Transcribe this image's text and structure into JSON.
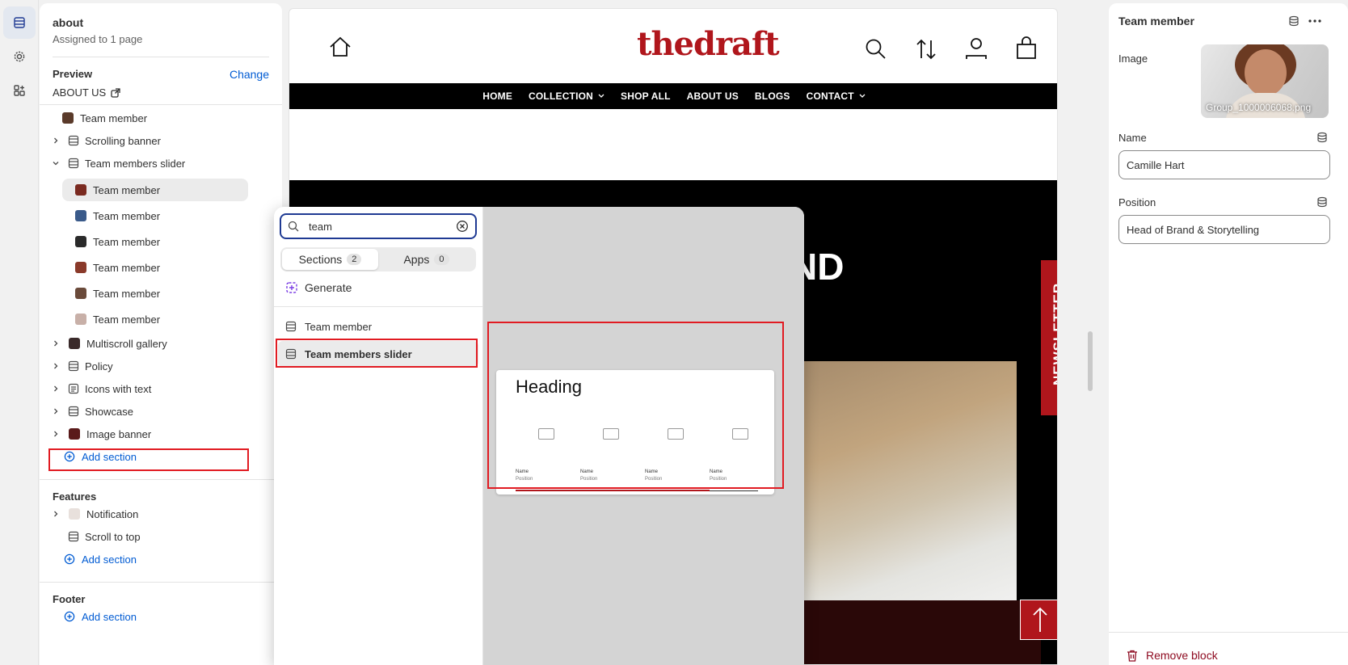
{
  "left_panel": {
    "page_name": "about",
    "assigned": "Assigned to 1 page",
    "preview_label": "Preview",
    "change_label": "Change",
    "preview_page": "ABOUT US",
    "tree": {
      "team_member_top": "Team member",
      "scrolling_banner": "Scrolling banner",
      "team_members_slider": "Team members slider",
      "members": [
        "Team member",
        "Team member",
        "Team member",
        "Team member",
        "Team member",
        "Team member"
      ],
      "multiscroll_gallery": "Multiscroll gallery",
      "policy": "Policy",
      "icons_with_text": "Icons with text",
      "showcase": "Showcase",
      "image_banner": "Image banner",
      "add_section": "Add section"
    },
    "features": {
      "title": "Features",
      "notification": "Notification",
      "scroll_to_top": "Scroll to top",
      "add_section": "Add section"
    },
    "footer": {
      "title": "Footer",
      "add_section": "Add section"
    }
  },
  "preview": {
    "logo_text": "thedraft",
    "nav": [
      {
        "label": "HOME",
        "dropdown": false
      },
      {
        "label": "COLLECTION",
        "dropdown": true
      },
      {
        "label": "SHOP ALL",
        "dropdown": false
      },
      {
        "label": "ABOUT US",
        "dropdown": false
      },
      {
        "label": "BLOGS",
        "dropdown": false
      },
      {
        "label": "CONTACT",
        "dropdown": true
      }
    ],
    "hero_partial": "ND",
    "newsletter": "NEWSLETTER"
  },
  "picker": {
    "search_value": "team",
    "tabs": [
      {
        "label": "Sections",
        "count": "2"
      },
      {
        "label": "Apps",
        "count": "0"
      }
    ],
    "generate": "Generate",
    "results": [
      "Team member",
      "Team members slider"
    ],
    "preview_card": {
      "heading": "Heading",
      "items": [
        {
          "name": "Name",
          "position": "Position"
        },
        {
          "name": "Name",
          "position": "Position"
        },
        {
          "name": "Name",
          "position": "Position"
        },
        {
          "name": "Name",
          "position": "Position"
        }
      ],
      "progress_fraction": 0.8
    }
  },
  "right_panel": {
    "title": "Team member",
    "image_label": "Image",
    "image_filename": "Group_1000006068.png",
    "name_label": "Name",
    "name_value": "Camille Hart",
    "position_label": "Position",
    "position_value": "Head of Brand & Storytelling",
    "remove_label": "Remove block"
  },
  "colors": {
    "accent_red": "#b0161c",
    "link_blue": "#005bd3",
    "highlight": "#e11b22"
  }
}
